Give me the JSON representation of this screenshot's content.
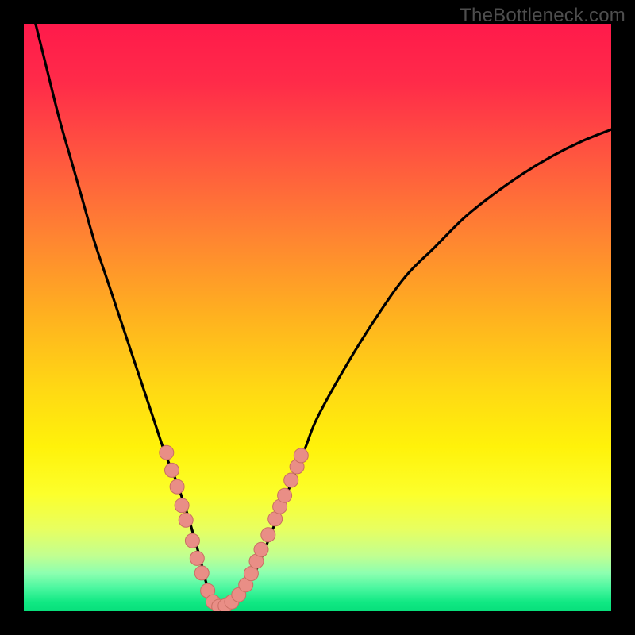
{
  "watermark": "TheBottleneck.com",
  "colors": {
    "frame": "#000000",
    "curve_stroke": "#000000",
    "dot_fill": "#e98e86",
    "dot_stroke": "#c96e63",
    "gradient_stops": [
      {
        "offset": 0.0,
        "color": "#ff1a4b"
      },
      {
        "offset": 0.1,
        "color": "#ff2b49"
      },
      {
        "offset": 0.22,
        "color": "#ff5440"
      },
      {
        "offset": 0.35,
        "color": "#ff8033"
      },
      {
        "offset": 0.5,
        "color": "#ffb21f"
      },
      {
        "offset": 0.62,
        "color": "#ffd814"
      },
      {
        "offset": 0.72,
        "color": "#fff20a"
      },
      {
        "offset": 0.8,
        "color": "#fcff2b"
      },
      {
        "offset": 0.86,
        "color": "#e8ff60"
      },
      {
        "offset": 0.905,
        "color": "#c2ff90"
      },
      {
        "offset": 0.935,
        "color": "#8dffb0"
      },
      {
        "offset": 0.96,
        "color": "#4cf7a0"
      },
      {
        "offset": 0.985,
        "color": "#10e883"
      },
      {
        "offset": 1.0,
        "color": "#08df7b"
      }
    ]
  },
  "chart_data": {
    "type": "line",
    "title": "",
    "xlabel": "",
    "ylabel": "",
    "xlim": [
      0,
      100
    ],
    "ylim": [
      0,
      100
    ],
    "series": [
      {
        "name": "bottleneck-curve",
        "x": [
          2,
          4,
          6,
          8,
          10,
          12,
          14,
          16,
          18,
          20,
          22,
          24,
          26,
          28,
          30,
          31,
          32,
          33,
          34,
          36,
          38,
          40,
          42,
          44,
          46,
          48,
          50,
          55,
          60,
          65,
          70,
          75,
          80,
          85,
          90,
          95,
          100
        ],
        "y": [
          100,
          92,
          84,
          77,
          70,
          63,
          57,
          51,
          45,
          39,
          33,
          27,
          22,
          16,
          9,
          5,
          2,
          0.8,
          0.6,
          1.5,
          4,
          8,
          13,
          18,
          23,
          28,
          33,
          42,
          50,
          57,
          62,
          67,
          71,
          74.5,
          77.5,
          80,
          82
        ]
      }
    ],
    "dots": {
      "name": "highlight-dots",
      "points": [
        {
          "x": 24.3,
          "y": 27.0
        },
        {
          "x": 25.2,
          "y": 24.0
        },
        {
          "x": 26.1,
          "y": 21.2
        },
        {
          "x": 26.9,
          "y": 18.0
        },
        {
          "x": 27.6,
          "y": 15.5
        },
        {
          "x": 28.7,
          "y": 12.0
        },
        {
          "x": 29.5,
          "y": 9.0
        },
        {
          "x": 30.3,
          "y": 6.5
        },
        {
          "x": 31.3,
          "y": 3.5
        },
        {
          "x": 32.2,
          "y": 1.6
        },
        {
          "x": 33.2,
          "y": 0.8
        },
        {
          "x": 34.3,
          "y": 0.9
        },
        {
          "x": 35.4,
          "y": 1.6
        },
        {
          "x": 36.6,
          "y": 2.8
        },
        {
          "x": 37.8,
          "y": 4.5
        },
        {
          "x": 38.7,
          "y": 6.4
        },
        {
          "x": 39.6,
          "y": 8.5
        },
        {
          "x": 40.4,
          "y": 10.5
        },
        {
          "x": 41.6,
          "y": 13.0
        },
        {
          "x": 42.8,
          "y": 15.7
        },
        {
          "x": 43.6,
          "y": 17.8
        },
        {
          "x": 44.4,
          "y": 19.7
        },
        {
          "x": 45.5,
          "y": 22.3
        },
        {
          "x": 46.5,
          "y": 24.6
        },
        {
          "x": 47.2,
          "y": 26.5
        }
      ],
      "radius_px": 9
    }
  }
}
